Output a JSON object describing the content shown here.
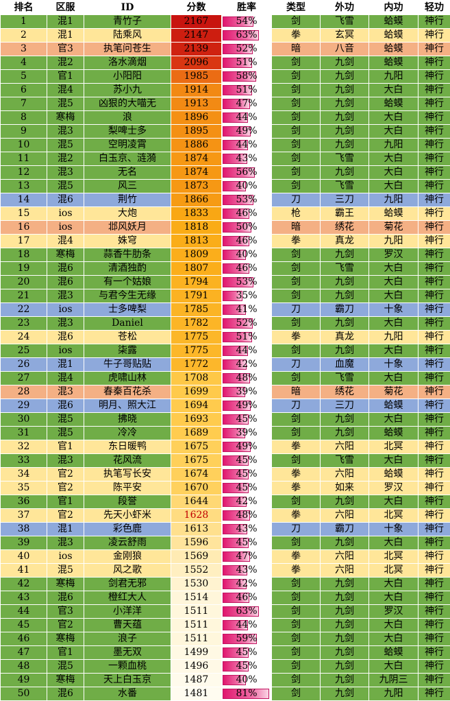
{
  "header": [
    "排名",
    "区服",
    "ID",
    "分数",
    "胜率",
    "类型",
    "外功",
    "内功",
    "轻功"
  ],
  "colors": {
    "green": "#70ad47",
    "light_yellow": "#ffe699",
    "salmon": "#f4b084",
    "blue": "#8ea9db",
    "highlight_score_text": "#c00000",
    "highlight_mark": "#ffff00"
  },
  "score_range": [
    1481,
    2167
  ],
  "rows": [
    {
      "rank": "1",
      "server": "混1",
      "id": "青竹子",
      "score": "2167",
      "win": "54%",
      "type": "剑",
      "outer": "飞雪",
      "inner": "蛤蟆",
      "light": "神行",
      "row_color": "green"
    },
    {
      "rank": "2",
      "server": "混1",
      "id": "陆乘风",
      "score": "2147",
      "win": "63%",
      "type": "拳",
      "outer": "玄冥",
      "inner": "蛤蟆",
      "light": "神行",
      "row_color": "light_yellow"
    },
    {
      "rank": "3",
      "server": "官3",
      "id": "执笔问苍生",
      "score": "2139",
      "win": "52%",
      "type": "暗",
      "outer": "八音",
      "inner": "蛤蟆",
      "light": "神行",
      "row_color": "salmon"
    },
    {
      "rank": "4",
      "server": "混2",
      "id": "洛水滴烟",
      "score": "2096",
      "win": "51%",
      "type": "剑",
      "outer": "九剑",
      "inner": "蛤蟆",
      "light": "神行",
      "row_color": "green"
    },
    {
      "rank": "5",
      "server": "官1",
      "id": "小阳阳",
      "score": "1985",
      "win": "58%",
      "type": "剑",
      "outer": "九剑",
      "inner": "九阳",
      "light": "神行",
      "row_color": "green"
    },
    {
      "rank": "6",
      "server": "混4",
      "id": "苏小九",
      "score": "1914",
      "win": "51%",
      "type": "剑",
      "outer": "九剑",
      "inner": "大白",
      "light": "神行",
      "row_color": "green"
    },
    {
      "rank": "7",
      "server": "混5",
      "id": "凶狠的大喵无",
      "score": "1913",
      "win": "47%",
      "type": "剑",
      "outer": "九剑",
      "inner": "蛤蟆",
      "light": "神行",
      "row_color": "green"
    },
    {
      "rank": "8",
      "server": "寒梅",
      "id": "浪",
      "score": "1896",
      "win": "44%",
      "type": "剑",
      "outer": "九剑",
      "inner": "大白",
      "light": "神行",
      "row_color": "green"
    },
    {
      "rank": "9",
      "server": "混3",
      "id": "梨啤士多",
      "score": "1895",
      "win": "49%",
      "type": "剑",
      "outer": "九剑",
      "inner": "大白",
      "light": "神行",
      "row_color": "green"
    },
    {
      "rank": "10",
      "server": "混5",
      "id": "空明凌霄",
      "score": "1886",
      "win": "44%",
      "type": "剑",
      "outer": "九剑",
      "inner": "九阳",
      "light": "神行",
      "row_color": "green"
    },
    {
      "rank": "11",
      "server": "混2",
      "id": "白玉京、涟漪",
      "score": "1874",
      "win": "43%",
      "type": "剑",
      "outer": "飞雪",
      "inner": "大白",
      "light": "神行",
      "row_color": "green"
    },
    {
      "rank": "12",
      "server": "混3",
      "id": "无名",
      "score": "1874",
      "win": "56%",
      "type": "剑",
      "outer": "九剑",
      "inner": "大白",
      "light": "神行",
      "row_color": "green"
    },
    {
      "rank": "13",
      "server": "混5",
      "id": "风三",
      "score": "1873",
      "win": "40%",
      "type": "剑",
      "outer": "飞雪",
      "inner": "大白",
      "light": "神行",
      "row_color": "green"
    },
    {
      "rank": "14",
      "server": "混6",
      "id": "荆竹",
      "score": "1866",
      "win": "53%",
      "type": "刀",
      "outer": "三刀",
      "inner": "九阳",
      "light": "神行",
      "row_color": "blue"
    },
    {
      "rank": "15",
      "server": "ios",
      "id": "大炮",
      "score": "1833",
      "win": "46%",
      "type": "枪",
      "outer": "霸王",
      "inner": "蛤蟆",
      "light": "神行",
      "row_color": "light_yellow"
    },
    {
      "rank": "16",
      "server": "ios",
      "id": "邶风妖月",
      "score": "1818",
      "win": "50%",
      "type": "暗",
      "outer": "绣花",
      "inner": "菊花",
      "light": "神行",
      "row_color": "salmon"
    },
    {
      "rank": "17",
      "server": "混4",
      "id": "姝穹",
      "score": "1813",
      "win": "46%",
      "type": "拳",
      "outer": "真龙",
      "inner": "九阳",
      "light": "神行",
      "row_color": "light_yellow"
    },
    {
      "rank": "18",
      "server": "寒梅",
      "id": "蒜香牛肋条",
      "score": "1809",
      "win": "40%",
      "type": "剑",
      "outer": "九剑",
      "inner": "罗汉",
      "light": "神行",
      "row_color": "green"
    },
    {
      "rank": "19",
      "server": "混6",
      "id": "清酒独酌",
      "score": "1807",
      "win": "46%",
      "type": "剑",
      "outer": "飞雪",
      "inner": "大白",
      "light": "神行",
      "row_color": "green"
    },
    {
      "rank": "20",
      "server": "混6",
      "id": "有一个姑娘",
      "score": "1794",
      "win": "53%",
      "type": "剑",
      "outer": "九剑",
      "inner": "大白",
      "light": "神行",
      "row_color": "green"
    },
    {
      "rank": "21",
      "server": "混3",
      "id": "与君今生无缘",
      "score": "1791",
      "win": "35%",
      "type": "剑",
      "outer": "九剑",
      "inner": "大白",
      "light": "神行",
      "row_color": "green"
    },
    {
      "rank": "22",
      "server": "ios",
      "id": "士多啤梨",
      "score": "1785",
      "win": "41%",
      "type": "刀",
      "outer": "霸刀",
      "inner": "十象",
      "light": "神行",
      "row_color": "blue"
    },
    {
      "rank": "23",
      "server": "混3",
      "id": "Daniel",
      "score": "1782",
      "win": "52%",
      "type": "剑",
      "outer": "九剑",
      "inner": "大白",
      "light": "神行",
      "row_color": "green"
    },
    {
      "rank": "24",
      "server": "混6",
      "id": "苍松",
      "score": "1775",
      "win": "51%",
      "type": "拳",
      "outer": "真龙",
      "inner": "九阳",
      "light": "神行",
      "row_color": "light_yellow"
    },
    {
      "rank": "25",
      "server": "ios",
      "id": "柒露",
      "score": "1775",
      "win": "44%",
      "type": "剑",
      "outer": "九剑",
      "inner": "大白",
      "light": "神行",
      "row_color": "green"
    },
    {
      "rank": "26",
      "server": "混1",
      "id": "牛子哥贴贴",
      "score": "1772",
      "win": "42%",
      "type": "刀",
      "outer": "血魔",
      "inner": "十象",
      "light": "神行",
      "row_color": "blue"
    },
    {
      "rank": "27",
      "server": "混4",
      "id": "虎啸山林",
      "score": "1708",
      "win": "48%",
      "type": "剑",
      "outer": "飞雪",
      "inner": "大白",
      "light": "神行",
      "row_color": "green"
    },
    {
      "rank": "28",
      "server": "混3",
      "id": "春秦百花杀",
      "score": "1699",
      "win": "39%",
      "type": "暗",
      "outer": "绣花",
      "inner": "菊花",
      "light": "神行",
      "row_color": "salmon"
    },
    {
      "rank": "29",
      "server": "混6",
      "id": "明月、照大江",
      "score": "1694",
      "win": "49%",
      "type": "刀",
      "outer": "三刀",
      "inner": "蛤蟆",
      "light": "神行",
      "row_color": "blue"
    },
    {
      "rank": "30",
      "server": "混5",
      "id": "拂晓",
      "score": "1693",
      "win": "45%",
      "type": "剑",
      "outer": "九剑",
      "inner": "大白",
      "light": "神行",
      "row_color": "green"
    },
    {
      "rank": "31",
      "server": "混5",
      "id": "冷冷",
      "score": "1689",
      "win": "39%",
      "type": "剑",
      "outer": "九剑",
      "inner": "蛤蟆",
      "light": "神行",
      "row_color": "green"
    },
    {
      "rank": "32",
      "server": "官1",
      "id": "东日暖鸭",
      "score": "1675",
      "win": "49%",
      "type": "拳",
      "outer": "六阳",
      "inner": "北冥",
      "light": "神行",
      "row_color": "light_yellow"
    },
    {
      "rank": "33",
      "server": "混3",
      "id": "花风流",
      "score": "1675",
      "win": "45%",
      "type": "剑",
      "outer": "飞雪",
      "inner": "大白",
      "light": "神行",
      "row_color": "green"
    },
    {
      "rank": "34",
      "server": "官2",
      "id": "执笔写长安",
      "score": "1674",
      "win": "45%",
      "type": "拳",
      "outer": "六阳",
      "inner": "蛤蟆",
      "light": "神行",
      "row_color": "light_yellow"
    },
    {
      "rank": "35",
      "server": "官2",
      "id": "陈平安",
      "score": "1670",
      "win": "45%",
      "type": "拳",
      "outer": "如来",
      "inner": "罗汉",
      "light": "神行",
      "row_color": "light_yellow"
    },
    {
      "rank": "36",
      "server": "官1",
      "id": "段誉",
      "score": "1644",
      "win": "42%",
      "type": "剑",
      "outer": "九剑",
      "inner": "大白",
      "light": "神行",
      "row_color": "green"
    },
    {
      "rank": "37",
      "server": "官2",
      "id": "先天小虾米",
      "score": "1628",
      "win": "48%",
      "type": "拳",
      "outer": "六阳",
      "inner": "北冥",
      "light": "神行",
      "row_color": "light_yellow",
      "highlight": true
    },
    {
      "rank": "38",
      "server": "混1",
      "id": "彩色鹿",
      "score": "1613",
      "win": "43%",
      "type": "刀",
      "outer": "霸刀",
      "inner": "十象",
      "light": "神行",
      "row_color": "blue"
    },
    {
      "rank": "39",
      "server": "混3",
      "id": "凌云舒雨",
      "score": "1596",
      "win": "45%",
      "type": "剑",
      "outer": "九剑",
      "inner": "大白",
      "light": "神行",
      "row_color": "green"
    },
    {
      "rank": "40",
      "server": "ios",
      "id": "金刚狼",
      "score": "1569",
      "win": "47%",
      "type": "拳",
      "outer": "六阳",
      "inner": "北冥",
      "light": "神行",
      "row_color": "light_yellow"
    },
    {
      "rank": "41",
      "server": "混5",
      "id": "风之歌",
      "score": "1552",
      "win": "43%",
      "type": "拳",
      "outer": "六阳",
      "inner": "北冥",
      "light": "神行",
      "row_color": "light_yellow"
    },
    {
      "rank": "42",
      "server": "寒梅",
      "id": "剑君无邪",
      "score": "1530",
      "win": "42%",
      "type": "剑",
      "outer": "九剑",
      "inner": "大白",
      "light": "神行",
      "row_color": "green"
    },
    {
      "rank": "43",
      "server": "混6",
      "id": "橙红大人",
      "score": "1514",
      "win": "46%",
      "type": "剑",
      "outer": "九剑",
      "inner": "大白",
      "light": "神行",
      "row_color": "green"
    },
    {
      "rank": "44",
      "server": "官3",
      "id": "小洋洋",
      "score": "1511",
      "win": "63%",
      "type": "剑",
      "outer": "九剑",
      "inner": "罗汉",
      "light": "神行",
      "row_color": "green"
    },
    {
      "rank": "45",
      "server": "官2",
      "id": "曹天蕴",
      "score": "1511",
      "win": "44%",
      "type": "剑",
      "outer": "九剑",
      "inner": "大白",
      "light": "神行",
      "row_color": "green"
    },
    {
      "rank": "46",
      "server": "寒梅",
      "id": "浪子",
      "score": "1511",
      "win": "59%",
      "type": "剑",
      "outer": "九剑",
      "inner": "大白",
      "light": "神行",
      "row_color": "green"
    },
    {
      "rank": "47",
      "server": "官1",
      "id": "墨无双",
      "score": "1499",
      "win": "45%",
      "type": "剑",
      "outer": "九剑",
      "inner": "蛤蟆",
      "light": "神行",
      "row_color": "green"
    },
    {
      "rank": "48",
      "server": "混5",
      "id": "一颗血桃",
      "score": "1496",
      "win": "45%",
      "type": "剑",
      "outer": "九剑",
      "inner": "大白",
      "light": "神行",
      "row_color": "green"
    },
    {
      "rank": "49",
      "server": "寒梅",
      "id": "天上白玉京",
      "score": "1487",
      "win": "40%",
      "type": "剑",
      "outer": "九剑",
      "inner": "九阴三",
      "light": "神行",
      "row_color": "green"
    },
    {
      "rank": "50",
      "server": "混6",
      "id": "水番",
      "score": "1481",
      "win": "81%",
      "type": "剑",
      "outer": "九剑",
      "inner": "九阳",
      "light": "神行",
      "row_color": "green"
    }
  ]
}
